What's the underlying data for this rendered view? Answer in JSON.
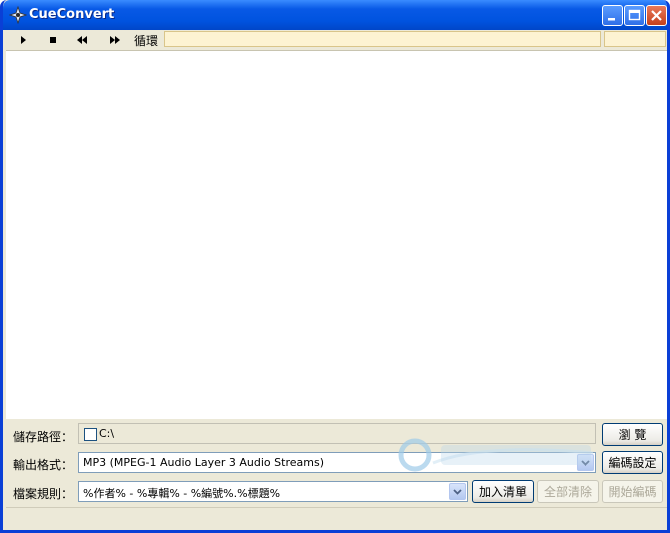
{
  "window": {
    "title": "CueConvert"
  },
  "toolbar": {
    "loop_label": "循環",
    "buttons": [
      "play-icon",
      "stop-icon",
      "rewind-icon",
      "fast-forward-icon"
    ]
  },
  "save_path": {
    "label": "儲存路徑：",
    "checked": false,
    "value": "C:\\",
    "browse_label": "瀏 覽"
  },
  "output_format": {
    "label": "輸出格式：",
    "value": "MP3  (MPEG-1 Audio Layer 3 Audio Streams)",
    "settings_label": "編碼設定"
  },
  "file_rule": {
    "label": "檔案規則：",
    "value": "%作者% - %專輯% - %編號%.%標題%",
    "add_label": "加入清單",
    "clear_label": "全部清除",
    "start_label": "開始編碼"
  },
  "colors": {
    "titlebar": "#0053df",
    "accent": "#003c74"
  }
}
